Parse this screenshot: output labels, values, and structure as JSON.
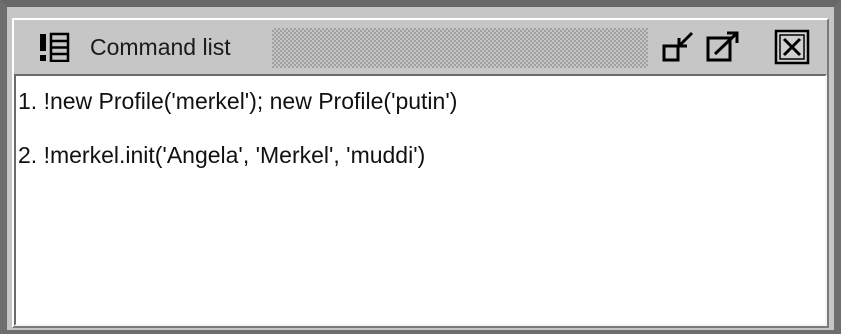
{
  "window": {
    "title": "Command list",
    "icons": {
      "title_icon": "command-list-icon",
      "dock": "dock-icon",
      "undock": "undock-icon",
      "close": "close-icon"
    }
  },
  "commands": [
    "1. !new Profile('merkel'); new Profile('putin')",
    "2. !merkel.init('Angela', 'Merkel', 'muddi')"
  ]
}
